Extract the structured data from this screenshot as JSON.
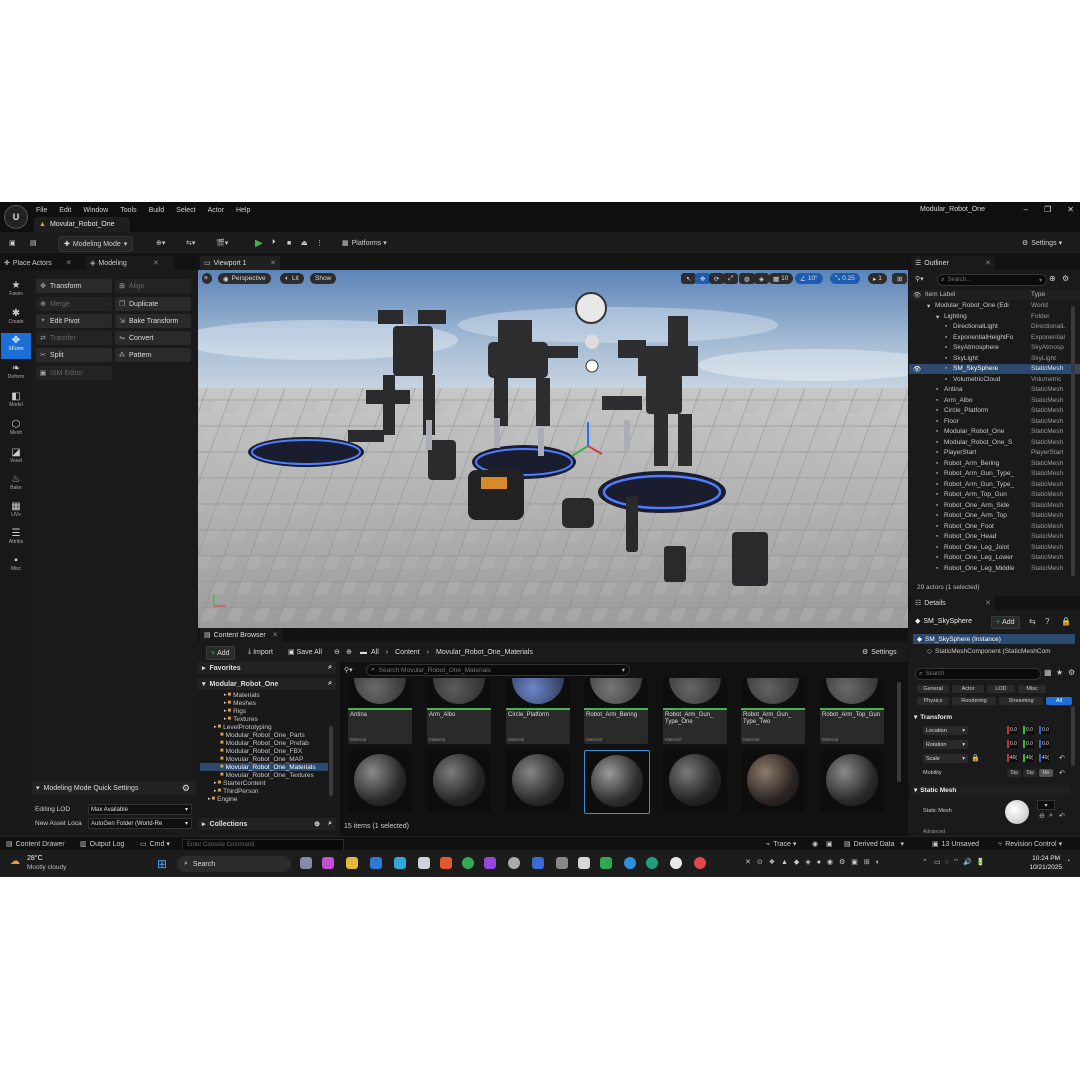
{
  "app": {
    "logo": "U",
    "menu": [
      "File",
      "Edit",
      "Window",
      "Tools",
      "Build",
      "Select",
      "Actor",
      "Help"
    ],
    "project_tab": "Movular_Robot_One",
    "project_name": "Modular_Robot_One",
    "window_controls": [
      "–",
      "❐",
      "✕"
    ]
  },
  "toolbar": {
    "mode": "Modeling Mode",
    "platforms": "Platforms",
    "settings": "Settings"
  },
  "left_panel": {
    "tabs": [
      "Place Actors",
      "Modeling"
    ],
    "side_items": [
      {
        "label": "Faves",
        "icon": "star-icon"
      },
      {
        "label": "Create",
        "icon": "create-icon"
      },
      {
        "label": "XForm",
        "icon": "xform-icon"
      },
      {
        "label": "Deform",
        "icon": "deform-icon"
      },
      {
        "label": "Model",
        "icon": "model-icon"
      },
      {
        "label": "Mesh",
        "icon": "mesh-icon"
      },
      {
        "label": "Voxel",
        "icon": "voxel-icon"
      },
      {
        "label": "Bake",
        "icon": "bake-icon"
      },
      {
        "label": "UVs",
        "icon": "uvs-icon"
      },
      {
        "label": "Attribs",
        "icon": "attribs-icon"
      },
      {
        "label": "Misc",
        "icon": "misc-icon"
      }
    ],
    "tools": [
      {
        "label": "Transform",
        "enabled": true
      },
      {
        "label": "Align",
        "enabled": false
      },
      {
        "label": "Merge",
        "enabled": false
      },
      {
        "label": "Duplicate",
        "enabled": true
      },
      {
        "label": "Edit Pivot",
        "enabled": true
      },
      {
        "label": "Bake Transform",
        "enabled": true
      },
      {
        "label": "Transfer",
        "enabled": false
      },
      {
        "label": "Convert",
        "enabled": true
      },
      {
        "label": "Split",
        "enabled": true
      },
      {
        "label": "Pattern",
        "enabled": true
      },
      {
        "label": "ISM Editor",
        "enabled": false
      }
    ],
    "quick_settings": {
      "title": "Modeling Mode Quick Settings",
      "editing_lod_label": "Editing LOD",
      "editing_lod_value": "Max Available",
      "new_asset_label": "New Asset Loca",
      "new_asset_value": "AutoGen Folder (World-Re"
    }
  },
  "viewport": {
    "tab": "Viewport 1",
    "perspective": "Perspective",
    "lit": "Lit",
    "show": "Show",
    "grid_snap": "10",
    "rot_snap": "10°",
    "scale_snap": "0.25",
    "camera": "1"
  },
  "content_browser": {
    "tab": "Content Browser",
    "add": "Add",
    "import": "Import",
    "save_all": "Save All",
    "settings": "Settings",
    "path": [
      "All",
      "Content",
      "Movular_Robot_One_Materials"
    ],
    "favorites": "Favorites",
    "root": "Modular_Robot_One",
    "tree": [
      {
        "label": "Materials",
        "indent": 2
      },
      {
        "label": "Meshes",
        "indent": 2
      },
      {
        "label": "Rigs",
        "indent": 2
      },
      {
        "label": "Textures",
        "indent": 2
      },
      {
        "label": "LevelPrototyping",
        "indent": 1
      },
      {
        "label": "Modular_Robot_One_Parts",
        "indent": 1
      },
      {
        "label": "Modular_Robot_One_Prefab",
        "indent": 1
      },
      {
        "label": "Modular_Robot_One_FBX",
        "indent": 1
      },
      {
        "label": "Movular_Robot_One_MAP",
        "indent": 1
      },
      {
        "label": "Movular_Robot_One_Materials",
        "indent": 1,
        "selected": true
      },
      {
        "label": "Movular_Robot_One_Textures",
        "indent": 1
      },
      {
        "label": "StarterContent",
        "indent": 1
      },
      {
        "label": "ThirdPerson",
        "indent": 1
      },
      {
        "label": "Engine",
        "indent": 0
      }
    ],
    "collections": "Collections",
    "search_placeholder": "Search Movular_Robot_One_Materials",
    "assets": [
      {
        "name": "Antina",
        "type": "Material"
      },
      {
        "name": "Arm_Albo",
        "type": "Material"
      },
      {
        "name": "Circle_Platform",
        "type": "Material"
      },
      {
        "name": "Robot_Arm_Bering",
        "type": "Material"
      },
      {
        "name": "Robot_Arm_Gun_ Type_One",
        "type": "Material"
      },
      {
        "name": "Robot_Arm_Gun_ Type_Two",
        "type": "Material"
      },
      {
        "name": "Robot_Arm_Top_Gun",
        "type": "Material"
      }
    ],
    "items_status": "15 items (1 selected)"
  },
  "outliner": {
    "tab": "Outliner",
    "search_placeholder": "Search...",
    "col_label": "Item Label",
    "col_type": "Type",
    "rows": [
      {
        "name": "Modular_Robot_One (Edi",
        "type": "World",
        "indent": 0,
        "icon": "▾"
      },
      {
        "name": "Lighting",
        "type": "Folder",
        "indent": 1,
        "icon": "▾"
      },
      {
        "name": "DirectionalLight",
        "type": "DirectionalL",
        "indent": 2
      },
      {
        "name": "ExponentialHeightFo",
        "type": "Exponential",
        "indent": 2
      },
      {
        "name": "SkyAtmosphere",
        "type": "SkyAtmosp",
        "indent": 2
      },
      {
        "name": "SkyLight",
        "type": "SkyLight",
        "indent": 2
      },
      {
        "name": "SM_SkySphere",
        "type": "StaticMesh",
        "indent": 2,
        "selected": true
      },
      {
        "name": "VolumetricCloud",
        "type": "Volumetric",
        "indent": 2
      },
      {
        "name": "Antina",
        "type": "StaticMesh",
        "indent": 1
      },
      {
        "name": "Arm_Albo",
        "type": "StaticMesh",
        "indent": 1
      },
      {
        "name": "Circle_Platform",
        "type": "StaticMesh",
        "indent": 1
      },
      {
        "name": "Floor",
        "type": "StaticMesh",
        "indent": 1
      },
      {
        "name": "Modular_Robot_One",
        "type": "StaticMesh",
        "indent": 1
      },
      {
        "name": "Modular_Robot_One_S",
        "type": "StaticMesh",
        "indent": 1
      },
      {
        "name": "PlayerStart",
        "type": "PlayerStart",
        "indent": 1
      },
      {
        "name": "Robot_Arm_Bering",
        "type": "StaticMesh",
        "indent": 1
      },
      {
        "name": "Robot_Arm_Gun_Type_",
        "type": "StaticMesh",
        "indent": 1
      },
      {
        "name": "Robot_Arm_Gun_Type_",
        "type": "StaticMesh",
        "indent": 1
      },
      {
        "name": "Robot_Arm_Top_Gun",
        "type": "StaticMesh",
        "indent": 1
      },
      {
        "name": "Robot_One_Arm_Side",
        "type": "StaticMesh",
        "indent": 1
      },
      {
        "name": "Robot_One_Arm_Top",
        "type": "StaticMesh",
        "indent": 1
      },
      {
        "name": "Robot_One_Foot",
        "type": "StaticMesh",
        "indent": 1
      },
      {
        "name": "Robot_One_Head",
        "type": "StaticMesh",
        "indent": 1
      },
      {
        "name": "Robot_One_Leg_Joint",
        "type": "StaticMesh",
        "indent": 1
      },
      {
        "name": "Robot_One_Leg_Lower",
        "type": "StaticMesh",
        "indent": 1
      },
      {
        "name": "Robot_One_Leg_Middle",
        "type": "StaticMesh",
        "indent": 1
      }
    ],
    "footer": "29 actors (1 selected)"
  },
  "details": {
    "tab": "Details",
    "object": "SM_SkySphere",
    "add": "Add",
    "instance": "SM_SkySphere (Instance)",
    "component": "StaticMeshComponent (StaticMeshCom",
    "search_placeholder": "Search",
    "filters_row1": [
      "General",
      "Actor",
      "LOD",
      "Misc"
    ],
    "filters_row2": [
      "Physics",
      "Rendering",
      "Streaming",
      "All"
    ],
    "transform_header": "Transform",
    "location": "Location",
    "rotation": "Rotation",
    "scale": "Scale",
    "loc_values": [
      "0.0",
      "0.0",
      "0.0"
    ],
    "rot_values": [
      "0.0",
      "0.0",
      "0.0"
    ],
    "scale_values": [
      "40(",
      "40(",
      "40("
    ],
    "mobility": "Mobility",
    "mobility_opts": [
      "Sta",
      "Sta",
      "Mo"
    ],
    "static_mesh_header": "Static Mesh",
    "static_mesh_label": "Static Mesh",
    "advanced": "Advanced"
  },
  "status_bar": {
    "content_drawer": "Content Drawer",
    "output_log": "Output Log",
    "cmd": "Cmd",
    "console_placeholder": "Enter Console Command",
    "trace": "Trace",
    "derived_data": "Derived Data",
    "unsaved": "13 Unsaved",
    "revision": "Revision Control"
  },
  "taskbar": {
    "temp": "28°C",
    "weather": "Mostly cloudy",
    "search": "Search",
    "time": "10:24 PM",
    "date": "10/21/2025"
  }
}
